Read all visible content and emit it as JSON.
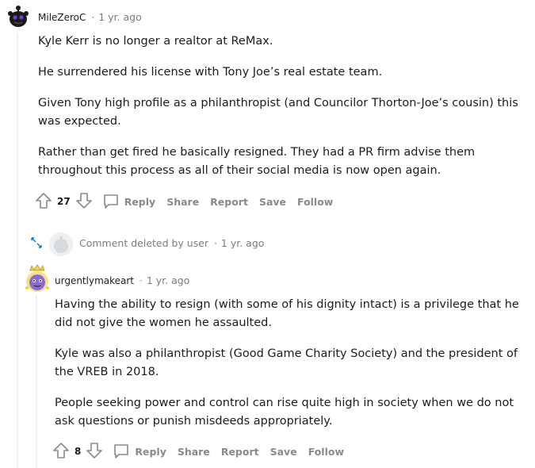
{
  "comment1": {
    "author": "MileZeroC",
    "separator": "·",
    "time": "1 yr. ago",
    "paragraphs": [
      "Kyle Kerr is no longer a realtor at ReMax.",
      "He surrendered his license with Tony Joe’s real estate team.",
      "Given Tony high profile as a philanthropist (and Councilor Thorton-Joe’s cousin) this was expected.",
      "Rather than get fired he basically resigned. They had a PR firm advise them throughout this process as all of their social media is now open again."
    ],
    "votes": "27",
    "actions": {
      "reply": "Reply",
      "share": "Share",
      "report": "Report",
      "save": "Save",
      "follow": "Follow"
    }
  },
  "deleted": {
    "text": "Comment deleted by user",
    "separator": "·",
    "time": "1 yr. ago"
  },
  "comment2": {
    "author": "urgentlymakeart",
    "separator": "·",
    "time": "1 yr. ago",
    "paragraphs": [
      "Having the ability to resign (with some of his dignity intact) is a privilege that he did not give the women he assaulted.",
      "Kyle was also a philanthropist (Good Game Charity Society) and the president of the VREB in 2018.",
      "People seeking power and control can rise quite high in society when we do not ask questions or punish misdeeds appropriately."
    ],
    "votes": "8",
    "actions": {
      "reply": "Reply",
      "share": "Share",
      "report": "Report",
      "save": "Save",
      "follow": "Follow"
    }
  },
  "colors": {
    "meta": "#7c7c7c",
    "action": "#878a8c",
    "thread": "#edeff1",
    "expand": "#0079d3"
  }
}
